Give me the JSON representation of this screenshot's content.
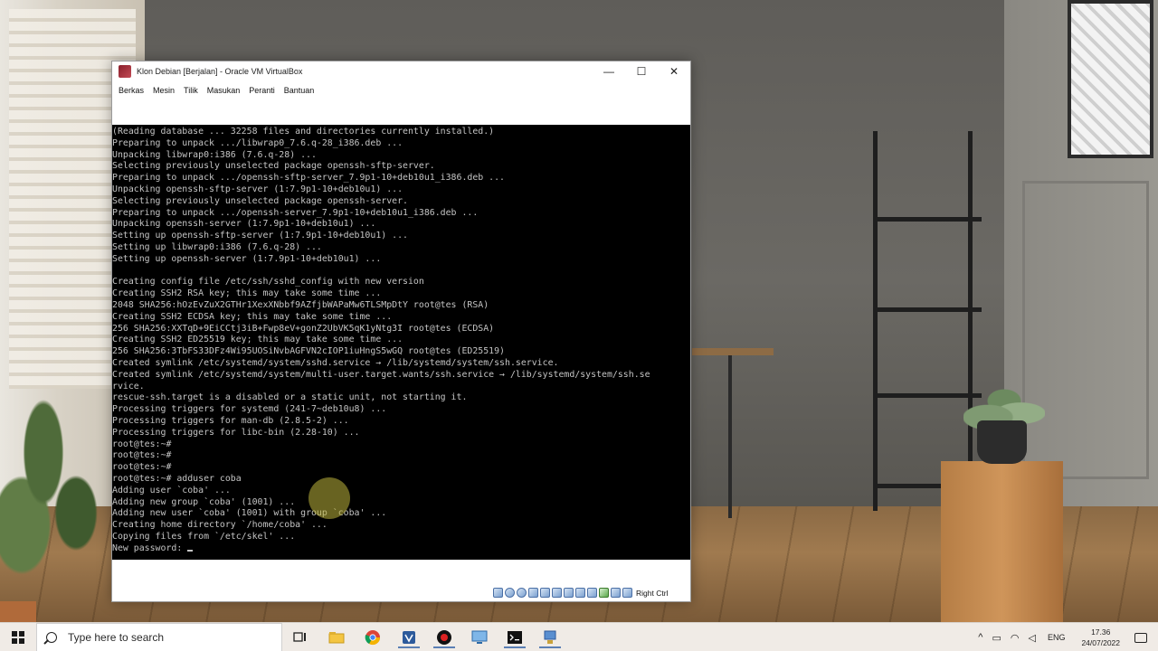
{
  "window": {
    "title": "Klon Debian [Berjalan] - Oracle VM VirtualBox",
    "minimize_glyph": "—",
    "maximize_glyph": "☐",
    "close_glyph": "✕"
  },
  "menubar": {
    "items": [
      "Berkas",
      "Mesin",
      "Tilik",
      "Masukan",
      "Peranti",
      "Bantuan"
    ]
  },
  "console": {
    "lines": [
      "(Reading database ... 32258 files and directories currently installed.)",
      "Preparing to unpack .../libwrap0_7.6.q-28_i386.deb ...",
      "Unpacking libwrap0:i386 (7.6.q-28) ...",
      "Selecting previously unselected package openssh-sftp-server.",
      "Preparing to unpack .../openssh-sftp-server_7.9p1-10+deb10u1_i386.deb ...",
      "Unpacking openssh-sftp-server (1:7.9p1-10+deb10u1) ...",
      "Selecting previously unselected package openssh-server.",
      "Preparing to unpack .../openssh-server_7.9p1-10+deb10u1_i386.deb ...",
      "Unpacking openssh-server (1:7.9p1-10+deb10u1) ...",
      "Setting up openssh-sftp-server (1:7.9p1-10+deb10u1) ...",
      "Setting up libwrap0:i386 (7.6.q-28) ...",
      "Setting up openssh-server (1:7.9p1-10+deb10u1) ...",
      "",
      "Creating config file /etc/ssh/sshd_config with new version",
      "Creating SSH2 RSA key; this may take some time ...",
      "2048 SHA256:hOzEvZuX2GTHr1XexXNbbf9AZfjbWAPaMw6TLSMpDtY root@tes (RSA)",
      "Creating SSH2 ECDSA key; this may take some time ...",
      "256 SHA256:XXTqD+9EiCCtj3iB+Fwp8eV+gonZ2UbVK5qK1yNtg3I root@tes (ECDSA)",
      "Creating SSH2 ED25519 key; this may take some time ...",
      "256 SHA256:3TbFS33DFz4Wi95UOSiNvbAGFVN2cIOP1iuHngS5wGQ root@tes (ED25519)",
      "Created symlink /etc/systemd/system/sshd.service → /lib/systemd/system/ssh.service.",
      "Created symlink /etc/systemd/system/multi-user.target.wants/ssh.service → /lib/systemd/system/ssh.se",
      "rvice.",
      "rescue-ssh.target is a disabled or a static unit, not starting it.",
      "Processing triggers for systemd (241-7~deb10u8) ...",
      "Processing triggers for man-db (2.8.5-2) ...",
      "Processing triggers for libc-bin (2.28-10) ...",
      "root@tes:~#",
      "root@tes:~#",
      "root@tes:~#",
      "root@tes:~# adduser coba",
      "Adding user `coba' ...",
      "Adding new group `coba' (1001) ...",
      "Adding new user `coba' (1001) with group `coba' ...",
      "Creating home directory `/home/coba' ...",
      "Copying files from `/etc/skel' ...",
      "New password: "
    ]
  },
  "statusbar": {
    "host_key": "Right Ctrl"
  },
  "taskbar": {
    "search_placeholder": "Type here to search",
    "apps": [
      "task-view",
      "file-explorer",
      "chrome",
      "virtualbox",
      "obs-recorder",
      "remote-desktop",
      "terminal",
      "network-tool"
    ],
    "language": "ENG",
    "time": "17.36",
    "date": "24/07/2022"
  }
}
